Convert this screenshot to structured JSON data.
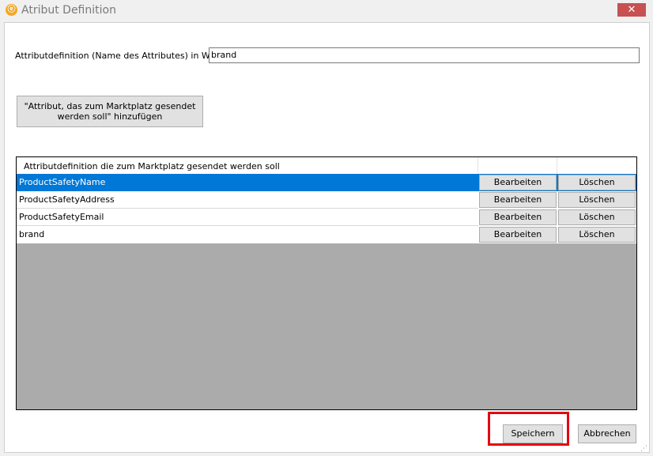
{
  "window": {
    "title": "Atribut Definition",
    "app_icon": "ⓔ",
    "close_icon": "✕"
  },
  "form": {
    "label": "Attributdefinition (Name des Attributes) in Wawi",
    "value": "brand"
  },
  "add_button": {
    "label": "\"Attribut, das zum Marktplatz gesendet\nwerden soll\"  hinzufügen"
  },
  "grid": {
    "header": "Attributdefinition die zum Marktplatz gesendet werden soll",
    "rows": [
      {
        "name": "ProductSafetyName",
        "edit": "Bearbeiten",
        "delete": "Löschen"
      },
      {
        "name": "ProductSafetyAddress",
        "edit": "Bearbeiten",
        "delete": "Löschen"
      },
      {
        "name": "ProductSafetyEmail",
        "edit": "Bearbeiten",
        "delete": "Löschen"
      },
      {
        "name": "brand",
        "edit": "Bearbeiten",
        "delete": "Löschen"
      }
    ],
    "selected_row": 0
  },
  "footer": {
    "save_label": "Speichern",
    "cancel_label": "Abbrechen"
  },
  "colors": {
    "selection": "#0078d7",
    "highlight_box": "#e30613",
    "close_button": "#c75050"
  }
}
